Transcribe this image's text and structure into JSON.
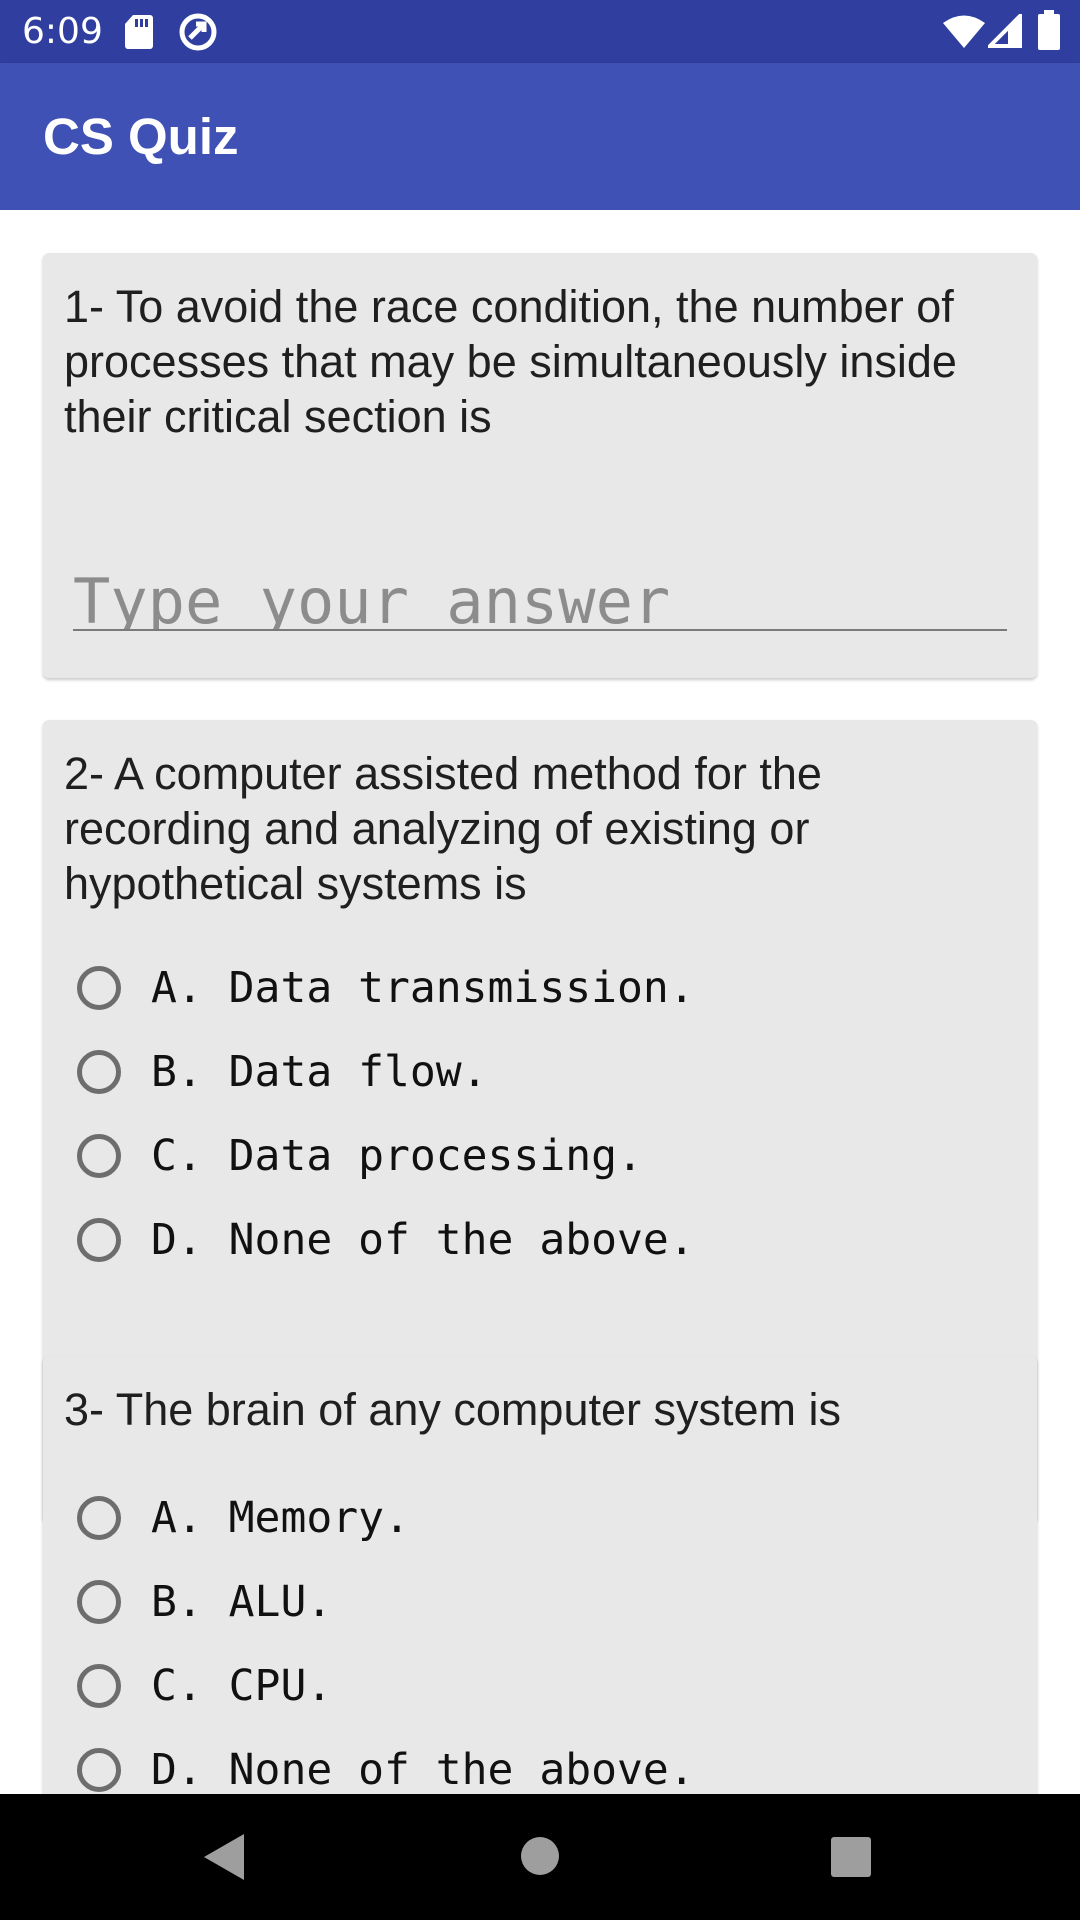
{
  "status_bar": {
    "time": "6:09"
  },
  "app_bar": {
    "title": "CS Quiz"
  },
  "questions": [
    {
      "text": "1- To avoid the race condition, the number of processes that may be simultaneously inside their critical section is",
      "input_placeholder": "Type your answer"
    },
    {
      "text": "2- A computer assisted method for the recording and analyzing of existing or hypothetical systems is",
      "options": [
        "A. Data transmission.",
        "B. Data flow.",
        "C. Data processing.",
        "D. None of the above."
      ]
    },
    {
      "text": "3- The brain of any computer system is",
      "options": [
        "A. Memory.",
        "B. ALU.",
        "C. CPU.",
        "D. None of the above."
      ]
    }
  ]
}
